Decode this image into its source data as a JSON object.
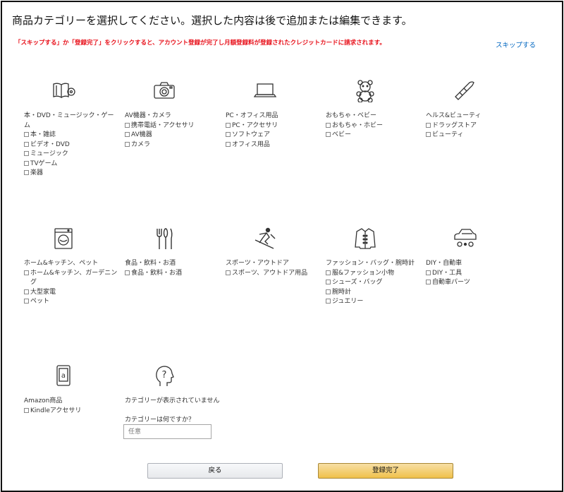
{
  "title": "商品カテゴリーを選択してください。選択した内容は後で追加または編集できます。",
  "warning": "「スキップする」か「登録完了」をクリックすると、アカウント登録が完了し月額登録料が登録されたクレジットカードに請求されます。",
  "skip_label": "スキップする",
  "categories": [
    {
      "icon": "book-dvd-icon",
      "heading": "本・DVD・ミュージック・ゲーム",
      "items": [
        "本・雑誌",
        "ビデオ・DVD",
        "ミュージック",
        "TVゲーム",
        "楽器"
      ]
    },
    {
      "icon": "camera-icon",
      "heading": "AV機器・カメラ",
      "items": [
        "携帯電話・アクセサリ",
        "AV機器",
        "カメラ"
      ]
    },
    {
      "icon": "laptop-icon",
      "heading": "PC・オフィス用品",
      "items": [
        "PC・アクセサリ",
        "ソフトウェア",
        "オフィス用品"
      ]
    },
    {
      "icon": "teddy-bear-icon",
      "heading": "おもちゃ・ベビー",
      "items": [
        "おもちゃ・ホビー",
        "ベビー"
      ]
    },
    {
      "icon": "lipstick-icon",
      "heading": "ヘルス&ビューティ",
      "items": [
        "ドラッグストア",
        "ビューティ"
      ]
    },
    {
      "icon": "washing-machine-icon",
      "heading": "ホーム&キッチン、ペット",
      "items": [
        "ホーム&キッチン、ガーデニング",
        "大型家電",
        "ペット"
      ]
    },
    {
      "icon": "cutlery-icon",
      "heading": "食品・飲料・お酒",
      "items": [
        "食品・飲料・お酒"
      ]
    },
    {
      "icon": "skier-icon",
      "heading": "スポーツ・アウトドア",
      "items": [
        "スポーツ、アウトドア用品"
      ]
    },
    {
      "icon": "jacket-icon",
      "heading": "ファッション・バッグ・腕時計",
      "items": [
        "服&ファッション小物",
        "シューズ・バッグ",
        "腕時計",
        "ジュエリー"
      ]
    },
    {
      "icon": "car-icon",
      "heading": "DIY・自動車",
      "items": [
        "DIY・工具",
        "自動車パーツ"
      ]
    },
    {
      "icon": "kindle-icon",
      "heading": "Amazon商品",
      "items": [
        "Kindleアクセサリ"
      ]
    },
    {
      "icon": "question-head-icon",
      "heading": "カテゴリーが表示されていません",
      "items": []
    }
  ],
  "other_question": "カテゴリーは何ですか？",
  "other_placeholder": "任意",
  "back_label": "戻る",
  "done_label": "登録完了"
}
